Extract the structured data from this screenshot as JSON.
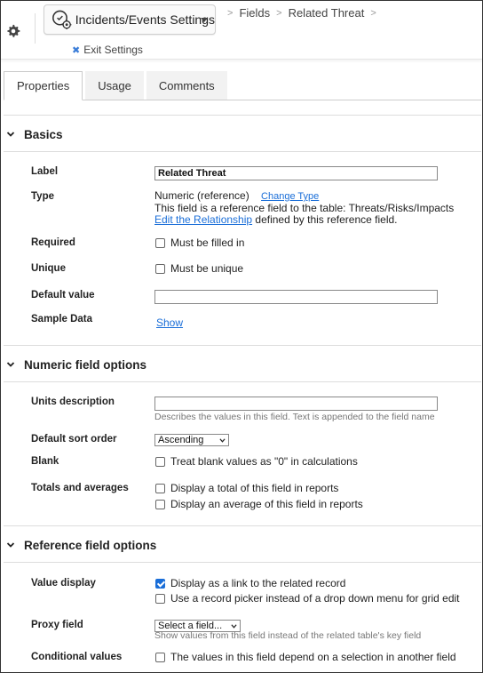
{
  "header": {
    "app_button_label": "Incidents/Events Settings",
    "breadcrumb": [
      "Fields",
      "Related Threat"
    ],
    "exit_label": "Exit Settings"
  },
  "tabs": [
    {
      "label": "Properties",
      "active": true
    },
    {
      "label": "Usage",
      "active": false
    },
    {
      "label": "Comments",
      "active": false
    }
  ],
  "basics": {
    "heading": "Basics",
    "label_label": "Label",
    "label_value": "Related Threat",
    "type_label": "Type",
    "type_value": "Numeric (reference)",
    "change_type": "Change Type",
    "type_note": "This field is a reference field to the table: Threats/Risks/Impacts",
    "edit_relationship": "Edit the Relationship",
    "relationship_note": " defined by this reference field.",
    "required_label": "Required",
    "required_option": "Must be filled in",
    "unique_label": "Unique",
    "unique_option": "Must be unique",
    "default_label": "Default value",
    "default_value": "",
    "sample_label": "Sample Data",
    "sample_link": "Show"
  },
  "numeric": {
    "heading": "Numeric field options",
    "units_label": "Units description",
    "units_value": "",
    "units_hint": "Describes the values in this field. Text is appended to the field name",
    "sort_label": "Default sort order",
    "sort_value": "Ascending",
    "blank_label": "Blank",
    "blank_option": "Treat blank values as \"0\" in calculations",
    "totals_label": "Totals and averages",
    "total_option": "Display a total of this field in reports",
    "average_option": "Display an average of this field in reports"
  },
  "reference": {
    "heading": "Reference field options",
    "display_label": "Value display",
    "link_option": "Display as a link to the related record",
    "link_checked": true,
    "picker_option": "Use a record picker instead of a drop down menu for grid edit",
    "proxy_label": "Proxy field",
    "proxy_value": "Select a field...",
    "proxy_hint": "Show values from this field instead of the related table's key field",
    "conditional_label": "Conditional values",
    "conditional_option": "The values in this field depend on a selection in another field"
  },
  "colors": {
    "link": "#1a6ed8",
    "checkbox_checked": "#1a6ed8"
  }
}
